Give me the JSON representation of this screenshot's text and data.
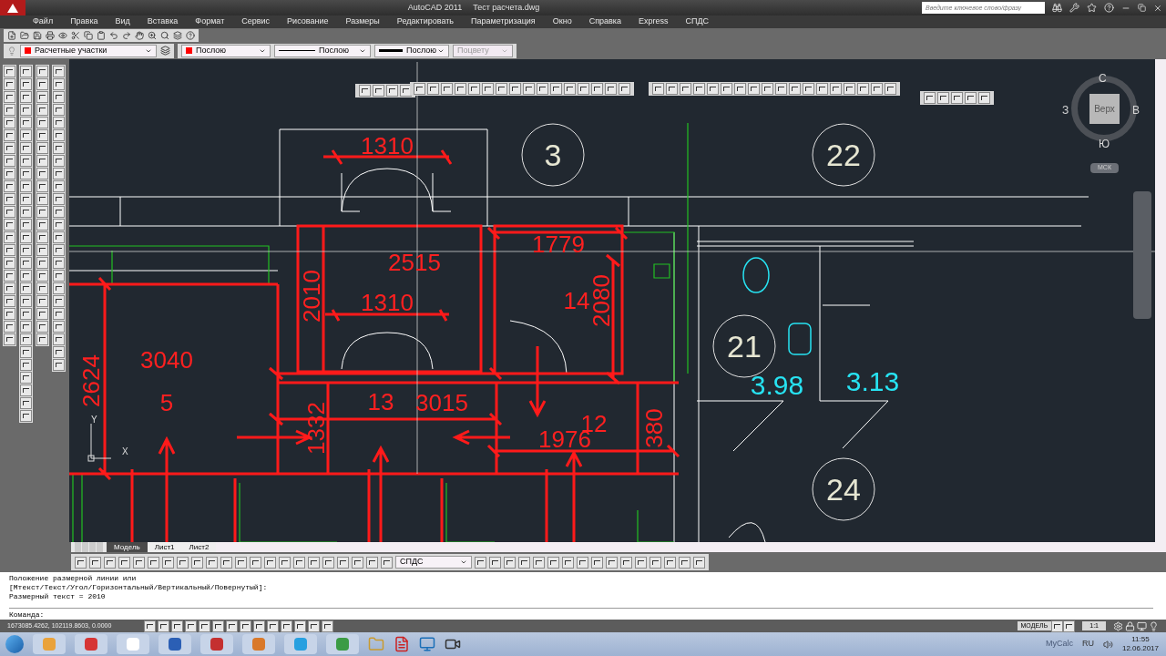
{
  "title_bar": {
    "app": "AutoCAD 2011",
    "document": "Тест расчета.dwg",
    "search": {
      "placeholder": "Введите ключевое слово/фразу"
    }
  },
  "menu": [
    "Файл",
    "Правка",
    "Вид",
    "Вставка",
    "Формат",
    "Сервис",
    "Рисование",
    "Размеры",
    "Редактировать",
    "Параметризация",
    "Окно",
    "Справка",
    "Express",
    "СПДС"
  ],
  "properties_bar": {
    "layer": {
      "value": "Расчетные участки",
      "color": "#ff0000"
    },
    "color": {
      "value": "Послою",
      "color": "#ff0000"
    },
    "linetype": "Послою",
    "lineweight": "Послою",
    "plot_style": {
      "value": "Поцвету",
      "disabled": true
    }
  },
  "drawing": {
    "labels": [
      {
        "kind": "dimension",
        "text": "1310",
        "rotated": false
      },
      {
        "kind": "room-number",
        "text": "3",
        "rotated": false
      },
      {
        "kind": "room-number",
        "text": "22",
        "rotated": false
      },
      {
        "kind": "dimension",
        "text": "1779",
        "rotated": false
      },
      {
        "kind": "dimension",
        "text": "2515",
        "rotated": false
      },
      {
        "kind": "dimension",
        "text": "2010",
        "rotated": true
      },
      {
        "kind": "dimension",
        "text": "1310",
        "rotated": false
      },
      {
        "kind": "dimension",
        "text": "14",
        "rotated": false
      },
      {
        "kind": "dimension",
        "text": "2080",
        "rotated": true
      },
      {
        "kind": "dimension",
        "text": "3040",
        "rotated": false
      },
      {
        "kind": "room-number",
        "text": "21",
        "rotated": false
      },
      {
        "kind": "area",
        "text": "3.98",
        "rotated": false
      },
      {
        "kind": "area",
        "text": "3.13",
        "rotated": false
      },
      {
        "kind": "dimension",
        "text": "2624",
        "rotated": true
      },
      {
        "kind": "dimension",
        "text": "5",
        "rotated": false
      },
      {
        "kind": "dimension",
        "text": "13",
        "rotated": false
      },
      {
        "kind": "dimension",
        "text": "3015",
        "rotated": false
      },
      {
        "kind": "dimension",
        "text": "12",
        "rotated": false
      },
      {
        "kind": "dimension",
        "text": "1332",
        "rotated": true
      },
      {
        "kind": "dimension",
        "text": "1976",
        "rotated": false
      },
      {
        "kind": "dimension",
        "text": "380",
        "rotated": true
      },
      {
        "kind": "room-number",
        "text": "24",
        "rotated": false
      }
    ]
  },
  "viewcube": {
    "north": "С",
    "west": "З",
    "east": "В",
    "south": "Ю",
    "face": "Верх",
    "ucs": "МСК"
  },
  "ucs_icon": {
    "y": "Y",
    "x": "X"
  },
  "layout_tabs": [
    {
      "label": "Модель",
      "selected": true
    },
    {
      "label": "Лист1",
      "selected": false
    },
    {
      "label": "Лист2",
      "selected": false
    }
  ],
  "bottom_toolbar": {
    "style": "СПДС"
  },
  "command_history": [
    "Положение размерной линии или",
    "[Мтекст/Текст/Угол/Горизонтальный/Вертикальный/Повернутый]:",
    "Размерный текст = 2010"
  ],
  "command_prompt": "Команда:",
  "status_bar": {
    "coordinates": "1673085.4262, 102119.8603, 0.0000",
    "space": "МОДЕЛЬ",
    "scale": "1:1"
  },
  "taskbar": {
    "tray_app": "MyCalc",
    "language": "RU",
    "time": "11:55",
    "date": "12.06.2017"
  }
}
